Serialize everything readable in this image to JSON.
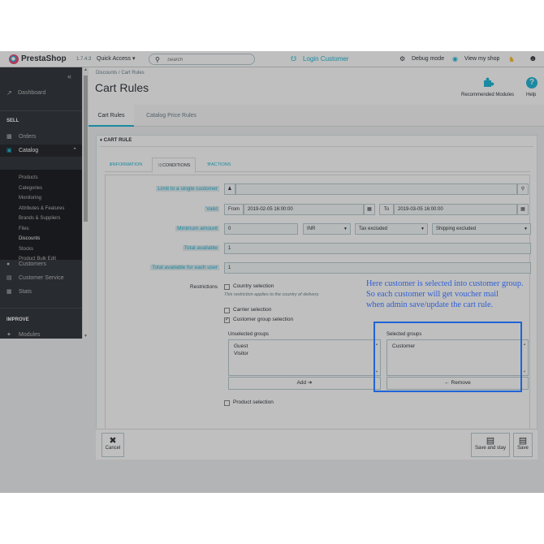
{
  "topbar": {
    "brand": "PrestaShop",
    "version": "1.7.4.3",
    "quick_access": "Quick Access ▾",
    "search_placeholder": "Search",
    "login_customer": "Login Customer",
    "debug_mode": "Debug mode",
    "view_shop": "View my shop"
  },
  "sidebar": {
    "dashboard": "Dashboard",
    "sell_heading": "SELL",
    "orders": "Orders",
    "catalog": "Catalog",
    "catalog_items": [
      "Products",
      "Categories",
      "Monitoring",
      "Attributes & Features",
      "Brands & Suppliers",
      "Files",
      "Discounts",
      "Stocks",
      "Product Bulk Edit"
    ],
    "customers": "Customers",
    "customer_service": "Customer Service",
    "stats": "Stats",
    "improve_heading": "IMPROVE",
    "modules": "Modules"
  },
  "header": {
    "breadcrumb": "Discounts  /  Cart Rules",
    "title": "Cart Rules",
    "recommended_modules": "Recommended Modules",
    "help": "Help"
  },
  "tabs": [
    "Cart Rules",
    "Catalog Price Rules"
  ],
  "panel": {
    "heading": "CART RULE",
    "inner_tabs": [
      "INFORMATION",
      "CONDITIONS",
      "ACTIONS"
    ]
  },
  "form": {
    "limit_label": "Limit to a single customer",
    "valid_label": "Valid",
    "from_label": "From",
    "from_value": "2019-02-05 16:00:00",
    "to_label": "To",
    "to_value": "2019-03-05 16:00:00",
    "min_amount_label": "Minimum amount",
    "min_amount_value": "0",
    "currency": "INR",
    "tax": "Tax excluded",
    "shipping": "Shipping excluded",
    "total_available_label": "Total available",
    "total_available_value": "1",
    "total_each_label": "Total available for each user",
    "total_each_value": "1",
    "restrictions_label": "Restrictions",
    "country_selection": "Country selection",
    "country_help": "This restriction applies to the country of delivery.",
    "carrier_selection": "Carrier selection",
    "customer_group_selection": "Customer group selection",
    "unselected_groups_label": "Unselected groups",
    "unselected_groups": [
      "Guest",
      "Visitor"
    ],
    "add_button": "Add ➔",
    "selected_groups_label": "Selected groups",
    "selected_groups": [
      "Customer"
    ],
    "remove_button": "← Remove",
    "product_selection": "Product selection"
  },
  "footer": {
    "cancel": "Cancel",
    "save_and_stay": "Save and stay",
    "save": "Save"
  },
  "annotation": {
    "lines": [
      "Here customer is selected into customer group.",
      "So each customer will get voucher mail",
      "when admin save/update the cart rule."
    ]
  },
  "colors": {
    "accent": "#25b9d7",
    "sidebar": "#363a41",
    "annotation": "#2e5fd6",
    "highlight_border": "#1f64d6"
  }
}
